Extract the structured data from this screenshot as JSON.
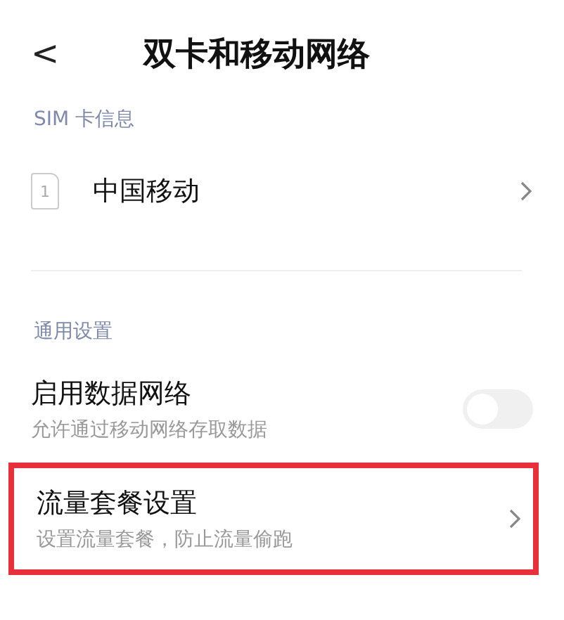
{
  "header": {
    "back": "<",
    "title": "双卡和移动网络"
  },
  "sections": [
    {
      "heading": "SIM 卡信息",
      "items": [
        {
          "kind": "sim",
          "slot": "1",
          "title": "中国移动",
          "highlighted": false
        }
      ]
    },
    {
      "heading": "通用设置",
      "items": [
        {
          "kind": "toggle",
          "title": "启用数据网络",
          "subtitle": "允许通过移动网络存取数据",
          "on": false,
          "highlighted": false
        },
        {
          "kind": "link",
          "title": "流量套餐设置",
          "subtitle": "设置流量套餐，防止流量偷跑",
          "highlighted": true
        }
      ]
    }
  ]
}
